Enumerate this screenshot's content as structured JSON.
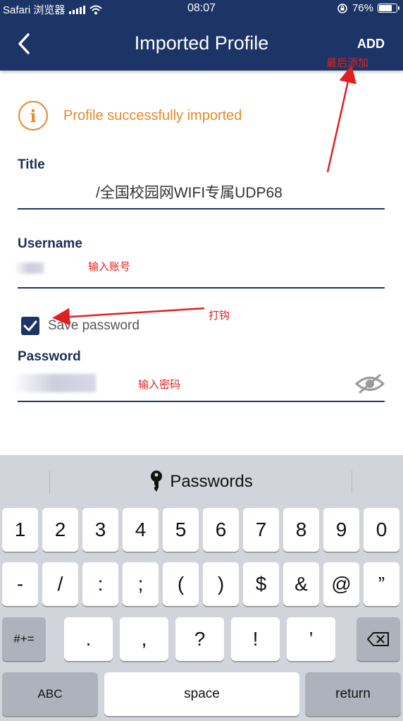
{
  "status_bar": {
    "carrier": "Safari 浏览器",
    "time": "08:07",
    "battery": "76%",
    "battery_level": 0.76
  },
  "nav": {
    "title": "Imported Profile",
    "add_label": "ADD"
  },
  "notice": {
    "text": "Profile successfully imported"
  },
  "form": {
    "title_label": "Title",
    "title_value": "/全国校园网WIFI专属UDP68",
    "username_label": "Username",
    "save_password_label": "Save password",
    "save_password_checked": true,
    "password_label": "Password"
  },
  "annotations": {
    "add_hint": "最后添加",
    "username_hint": "输入账号",
    "checkbox_hint": "打钩",
    "password_hint": "输入密码"
  },
  "keyboard": {
    "suggestion": "Passwords",
    "row1": [
      "1",
      "2",
      "3",
      "4",
      "5",
      "6",
      "7",
      "8",
      "9",
      "0"
    ],
    "row2": [
      "-",
      "/",
      ":",
      ";",
      "(",
      ")",
      "$",
      "&",
      "@",
      "”"
    ],
    "row3": [
      ".",
      ",",
      "?",
      "!",
      "’"
    ],
    "mode_key": "#+=",
    "abc_key": "ABC",
    "space_key": "space",
    "return_key": "return"
  },
  "colors": {
    "nav": "#1c3566",
    "accent": "#e58a2a",
    "annotation": "#e02020"
  }
}
